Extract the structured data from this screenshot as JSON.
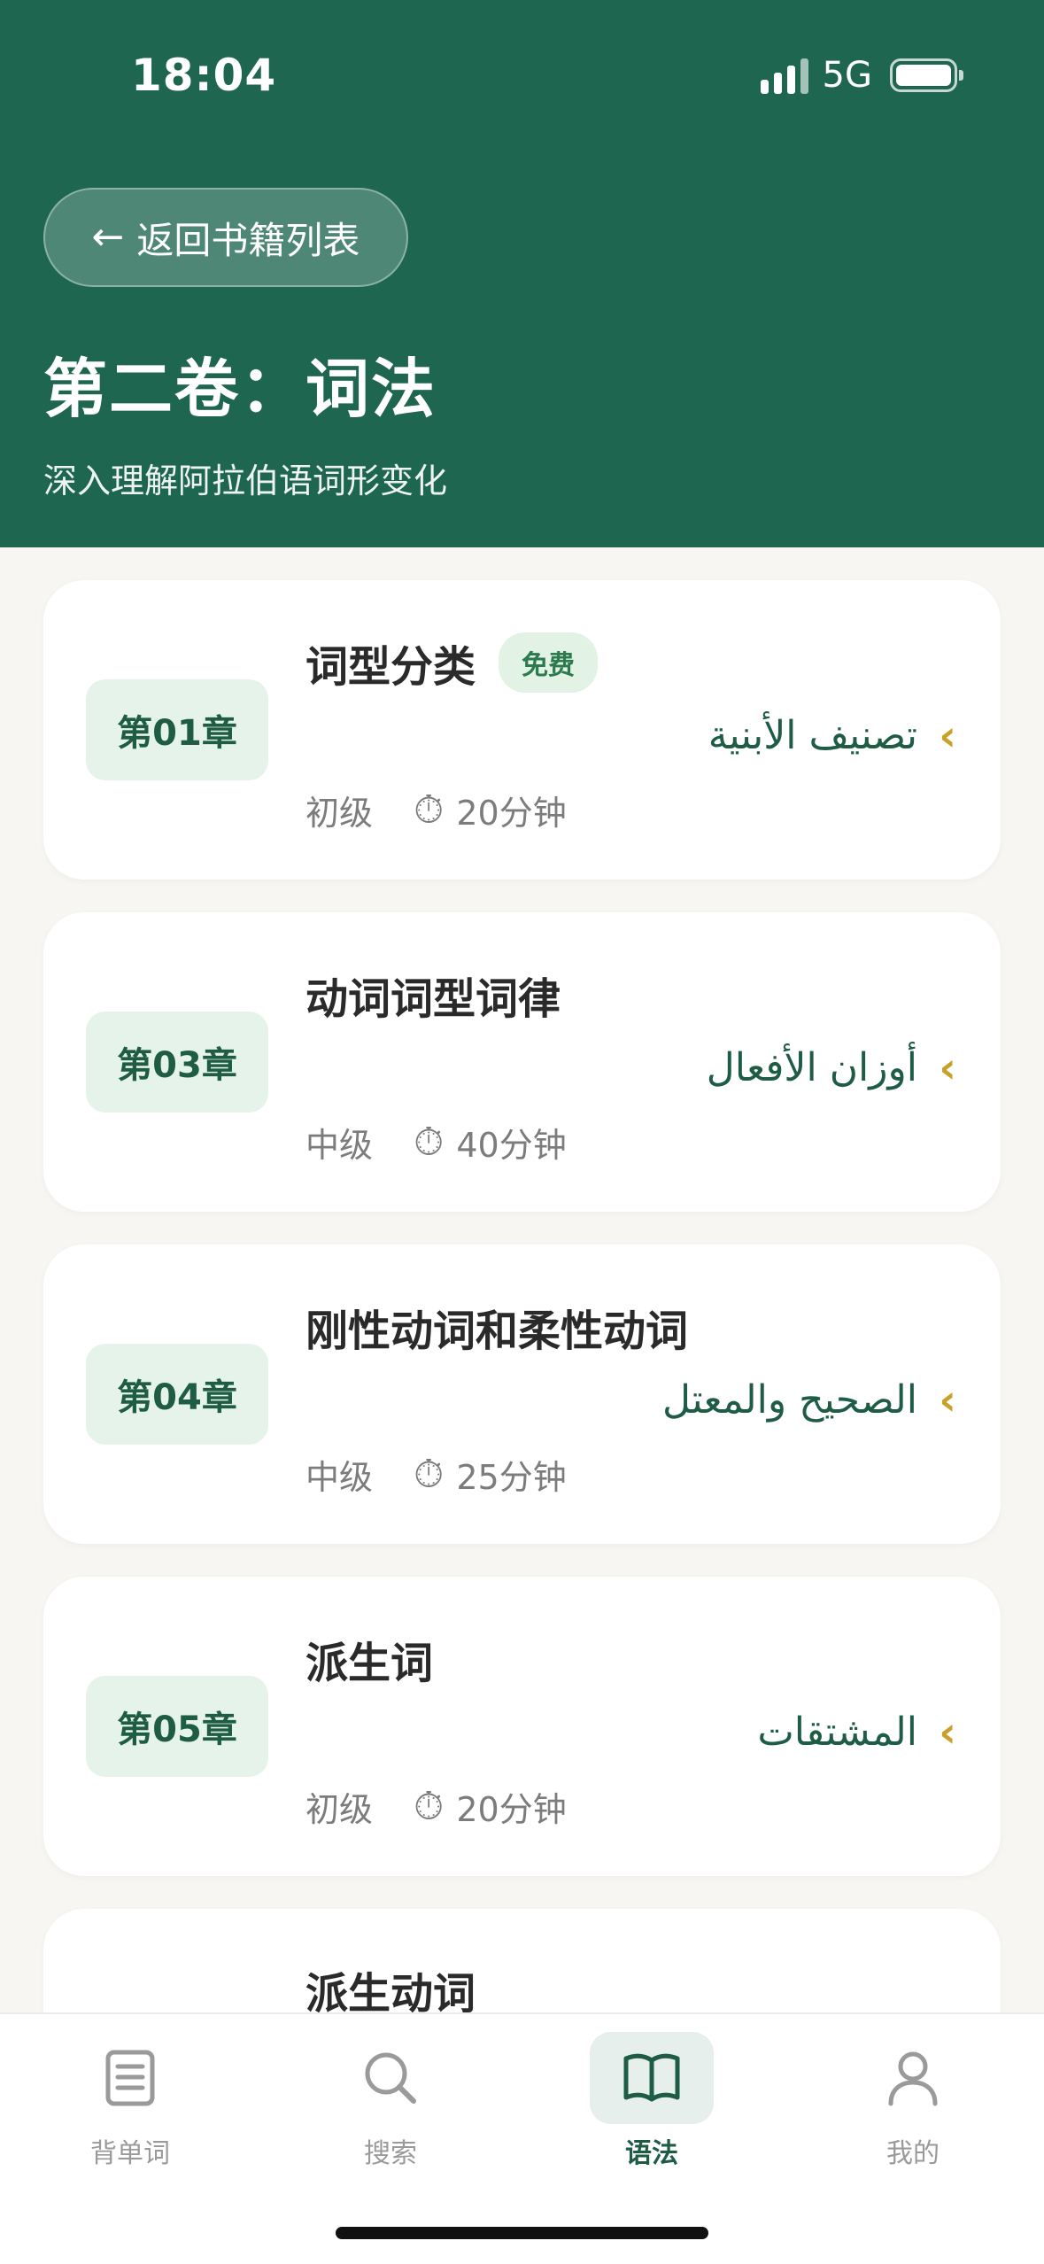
{
  "status_bar": {
    "time": "18:04",
    "network": "5G"
  },
  "header": {
    "back_label": "返回书籍列表",
    "title": "第二卷：词法",
    "subtitle": "深入理解阿拉伯语词形变化"
  },
  "chapters": [
    {
      "badge": "第01章",
      "title": "词型分类",
      "free_tag": "免费",
      "arabic": "تصنيف الأبنية",
      "level": "初级",
      "duration": "20分钟"
    },
    {
      "badge": "第03章",
      "title": "动词词型词律",
      "arabic": "أوزان الأفعال",
      "level": "中级",
      "duration": "40分钟"
    },
    {
      "badge": "第04章",
      "title": "刚性动词和柔性动词",
      "arabic": "الصحيح والمعتل",
      "level": "中级",
      "duration": "25分钟"
    },
    {
      "badge": "第05章",
      "title": "派生词",
      "arabic": "المشتقات",
      "level": "初级",
      "duration": "20分钟"
    },
    {
      "title": "派生动词"
    }
  ],
  "bottom_nav": {
    "items": [
      {
        "label": "背单词",
        "icon": "vocabulary-book-icon"
      },
      {
        "label": "搜索",
        "icon": "search-icon"
      },
      {
        "label": "语法",
        "icon": "open-book-icon",
        "active": true
      },
      {
        "label": "我的",
        "icon": "profile-icon"
      }
    ]
  },
  "colors": {
    "header_bg": "#1e6650",
    "badge_bg": "#e6f3ea",
    "chevron": "#c9a12a",
    "active_nav": "#1e5c45"
  }
}
